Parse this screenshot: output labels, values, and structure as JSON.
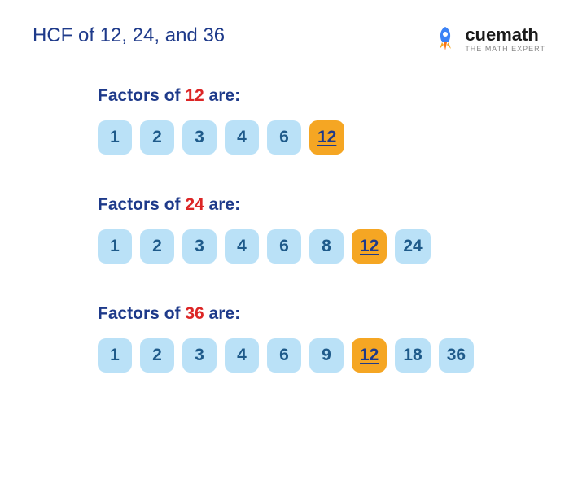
{
  "title": "HCF of 12, 24, and 36",
  "logo": {
    "text": "cuemath",
    "tagline": "THE MATH EXPERT"
  },
  "sections": [
    {
      "label_prefix": "Factors of ",
      "label_num": "12",
      "label_suffix": " are:",
      "chips": [
        {
          "value": "1",
          "highlight": false
        },
        {
          "value": "2",
          "highlight": false
        },
        {
          "value": "3",
          "highlight": false
        },
        {
          "value": "4",
          "highlight": false
        },
        {
          "value": "6",
          "highlight": false
        },
        {
          "value": "12",
          "highlight": true
        }
      ]
    },
    {
      "label_prefix": "Factors of ",
      "label_num": "24",
      "label_suffix": " are:",
      "chips": [
        {
          "value": "1",
          "highlight": false
        },
        {
          "value": "2",
          "highlight": false
        },
        {
          "value": "3",
          "highlight": false
        },
        {
          "value": "4",
          "highlight": false
        },
        {
          "value": "6",
          "highlight": false
        },
        {
          "value": "8",
          "highlight": false
        },
        {
          "value": "12",
          "highlight": true
        },
        {
          "value": "24",
          "highlight": false
        }
      ]
    },
    {
      "label_prefix": "Factors of ",
      "label_num": "36",
      "label_suffix": " are:",
      "chips": [
        {
          "value": "1",
          "highlight": false
        },
        {
          "value": "2",
          "highlight": false
        },
        {
          "value": "3",
          "highlight": false
        },
        {
          "value": "4",
          "highlight": false
        },
        {
          "value": "6",
          "highlight": false
        },
        {
          "value": "9",
          "highlight": false
        },
        {
          "value": "12",
          "highlight": true
        },
        {
          "value": "18",
          "highlight": false
        },
        {
          "value": "36",
          "highlight": false
        }
      ]
    }
  ],
  "chart_data": {
    "type": "table",
    "title": "HCF of 12, 24, and 36",
    "numbers": [
      12,
      24,
      36
    ],
    "factors": {
      "12": [
        1,
        2,
        3,
        4,
        6,
        12
      ],
      "24": [
        1,
        2,
        3,
        4,
        6,
        8,
        12,
        24
      ],
      "36": [
        1,
        2,
        3,
        4,
        6,
        9,
        12,
        18,
        36
      ]
    },
    "hcf": 12
  }
}
